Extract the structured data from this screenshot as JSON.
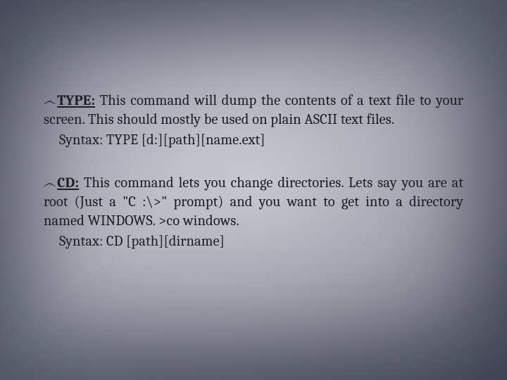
{
  "bullet_glyph": "෴",
  "items": [
    {
      "command": "TYPE:",
      "description": " This command will dump the contents of a text file to your screen. This should mostly be used on plain ASCII text files.",
      "syntax": "Syntax: TYPE [d:][path][name.ext]"
    },
    {
      "command": "CD:",
      "description": " This command lets you change directories. Lets say you are at root (Just a \"C :\\>\" prompt) and you want to get into a directory named WINDOWS. >co windows.",
      "syntax": "Syntax: CD [path][dirname]"
    }
  ]
}
